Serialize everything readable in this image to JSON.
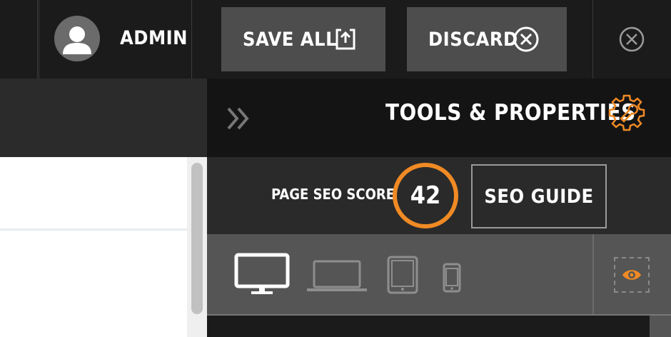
{
  "topbar": {
    "user_label": "ADMIN",
    "save_label": "SAVE ALL",
    "discard_label": "DISCARD"
  },
  "panel": {
    "title": "TOOLS & PROPERTIES",
    "seo_label": "PAGE SEO SCORE",
    "seo_score": "42",
    "seo_guide_label": "SEO GUIDE"
  },
  "icons": {
    "user": "user-avatar-icon",
    "save": "save-upload-icon",
    "discard": "close-circle-icon",
    "close": "close-circle-icon",
    "collapse": "double-chevron-right-icon",
    "settings": "gear-wrench-icon",
    "devices": [
      "desktop-icon",
      "laptop-icon",
      "tablet-icon",
      "phone-icon"
    ],
    "preview": "eye-icon"
  },
  "colors": {
    "accent": "#f08a24",
    "background": "#1b1b1b",
    "button": "#4d4d4d",
    "device_bar": "#555555"
  },
  "devices": {
    "selected": "desktop"
  }
}
